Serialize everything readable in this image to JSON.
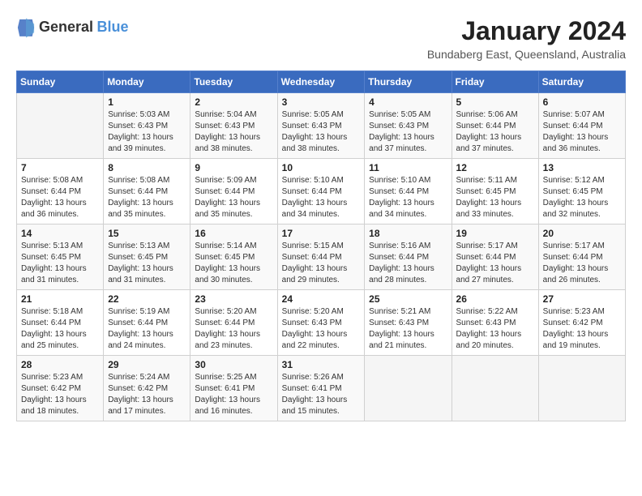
{
  "logo": {
    "general": "General",
    "blue": "Blue"
  },
  "title": "January 2024",
  "location": "Bundaberg East, Queensland, Australia",
  "weekdays": [
    "Sunday",
    "Monday",
    "Tuesday",
    "Wednesday",
    "Thursday",
    "Friday",
    "Saturday"
  ],
  "weeks": [
    [
      {
        "day": "",
        "sunrise": "",
        "sunset": "",
        "daylight": ""
      },
      {
        "day": "1",
        "sunrise": "Sunrise: 5:03 AM",
        "sunset": "Sunset: 6:43 PM",
        "daylight": "Daylight: 13 hours and 39 minutes."
      },
      {
        "day": "2",
        "sunrise": "Sunrise: 5:04 AM",
        "sunset": "Sunset: 6:43 PM",
        "daylight": "Daylight: 13 hours and 38 minutes."
      },
      {
        "day": "3",
        "sunrise": "Sunrise: 5:05 AM",
        "sunset": "Sunset: 6:43 PM",
        "daylight": "Daylight: 13 hours and 38 minutes."
      },
      {
        "day": "4",
        "sunrise": "Sunrise: 5:05 AM",
        "sunset": "Sunset: 6:43 PM",
        "daylight": "Daylight: 13 hours and 37 minutes."
      },
      {
        "day": "5",
        "sunrise": "Sunrise: 5:06 AM",
        "sunset": "Sunset: 6:44 PM",
        "daylight": "Daylight: 13 hours and 37 minutes."
      },
      {
        "day": "6",
        "sunrise": "Sunrise: 5:07 AM",
        "sunset": "Sunset: 6:44 PM",
        "daylight": "Daylight: 13 hours and 36 minutes."
      }
    ],
    [
      {
        "day": "7",
        "sunrise": "Sunrise: 5:08 AM",
        "sunset": "Sunset: 6:44 PM",
        "daylight": "Daylight: 13 hours and 36 minutes."
      },
      {
        "day": "8",
        "sunrise": "Sunrise: 5:08 AM",
        "sunset": "Sunset: 6:44 PM",
        "daylight": "Daylight: 13 hours and 35 minutes."
      },
      {
        "day": "9",
        "sunrise": "Sunrise: 5:09 AM",
        "sunset": "Sunset: 6:44 PM",
        "daylight": "Daylight: 13 hours and 35 minutes."
      },
      {
        "day": "10",
        "sunrise": "Sunrise: 5:10 AM",
        "sunset": "Sunset: 6:44 PM",
        "daylight": "Daylight: 13 hours and 34 minutes."
      },
      {
        "day": "11",
        "sunrise": "Sunrise: 5:10 AM",
        "sunset": "Sunset: 6:44 PM",
        "daylight": "Daylight: 13 hours and 34 minutes."
      },
      {
        "day": "12",
        "sunrise": "Sunrise: 5:11 AM",
        "sunset": "Sunset: 6:45 PM",
        "daylight": "Daylight: 13 hours and 33 minutes."
      },
      {
        "day": "13",
        "sunrise": "Sunrise: 5:12 AM",
        "sunset": "Sunset: 6:45 PM",
        "daylight": "Daylight: 13 hours and 32 minutes."
      }
    ],
    [
      {
        "day": "14",
        "sunrise": "Sunrise: 5:13 AM",
        "sunset": "Sunset: 6:45 PM",
        "daylight": "Daylight: 13 hours and 31 minutes."
      },
      {
        "day": "15",
        "sunrise": "Sunrise: 5:13 AM",
        "sunset": "Sunset: 6:45 PM",
        "daylight": "Daylight: 13 hours and 31 minutes."
      },
      {
        "day": "16",
        "sunrise": "Sunrise: 5:14 AM",
        "sunset": "Sunset: 6:45 PM",
        "daylight": "Daylight: 13 hours and 30 minutes."
      },
      {
        "day": "17",
        "sunrise": "Sunrise: 5:15 AM",
        "sunset": "Sunset: 6:44 PM",
        "daylight": "Daylight: 13 hours and 29 minutes."
      },
      {
        "day": "18",
        "sunrise": "Sunrise: 5:16 AM",
        "sunset": "Sunset: 6:44 PM",
        "daylight": "Daylight: 13 hours and 28 minutes."
      },
      {
        "day": "19",
        "sunrise": "Sunrise: 5:17 AM",
        "sunset": "Sunset: 6:44 PM",
        "daylight": "Daylight: 13 hours and 27 minutes."
      },
      {
        "day": "20",
        "sunrise": "Sunrise: 5:17 AM",
        "sunset": "Sunset: 6:44 PM",
        "daylight": "Daylight: 13 hours and 26 minutes."
      }
    ],
    [
      {
        "day": "21",
        "sunrise": "Sunrise: 5:18 AM",
        "sunset": "Sunset: 6:44 PM",
        "daylight": "Daylight: 13 hours and 25 minutes."
      },
      {
        "day": "22",
        "sunrise": "Sunrise: 5:19 AM",
        "sunset": "Sunset: 6:44 PM",
        "daylight": "Daylight: 13 hours and 24 minutes."
      },
      {
        "day": "23",
        "sunrise": "Sunrise: 5:20 AM",
        "sunset": "Sunset: 6:44 PM",
        "daylight": "Daylight: 13 hours and 23 minutes."
      },
      {
        "day": "24",
        "sunrise": "Sunrise: 5:20 AM",
        "sunset": "Sunset: 6:43 PM",
        "daylight": "Daylight: 13 hours and 22 minutes."
      },
      {
        "day": "25",
        "sunrise": "Sunrise: 5:21 AM",
        "sunset": "Sunset: 6:43 PM",
        "daylight": "Daylight: 13 hours and 21 minutes."
      },
      {
        "day": "26",
        "sunrise": "Sunrise: 5:22 AM",
        "sunset": "Sunset: 6:43 PM",
        "daylight": "Daylight: 13 hours and 20 minutes."
      },
      {
        "day": "27",
        "sunrise": "Sunrise: 5:23 AM",
        "sunset": "Sunset: 6:42 PM",
        "daylight": "Daylight: 13 hours and 19 minutes."
      }
    ],
    [
      {
        "day": "28",
        "sunrise": "Sunrise: 5:23 AM",
        "sunset": "Sunset: 6:42 PM",
        "daylight": "Daylight: 13 hours and 18 minutes."
      },
      {
        "day": "29",
        "sunrise": "Sunrise: 5:24 AM",
        "sunset": "Sunset: 6:42 PM",
        "daylight": "Daylight: 13 hours and 17 minutes."
      },
      {
        "day": "30",
        "sunrise": "Sunrise: 5:25 AM",
        "sunset": "Sunset: 6:41 PM",
        "daylight": "Daylight: 13 hours and 16 minutes."
      },
      {
        "day": "31",
        "sunrise": "Sunrise: 5:26 AM",
        "sunset": "Sunset: 6:41 PM",
        "daylight": "Daylight: 13 hours and 15 minutes."
      },
      {
        "day": "",
        "sunrise": "",
        "sunset": "",
        "daylight": ""
      },
      {
        "day": "",
        "sunrise": "",
        "sunset": "",
        "daylight": ""
      },
      {
        "day": "",
        "sunrise": "",
        "sunset": "",
        "daylight": ""
      }
    ]
  ]
}
